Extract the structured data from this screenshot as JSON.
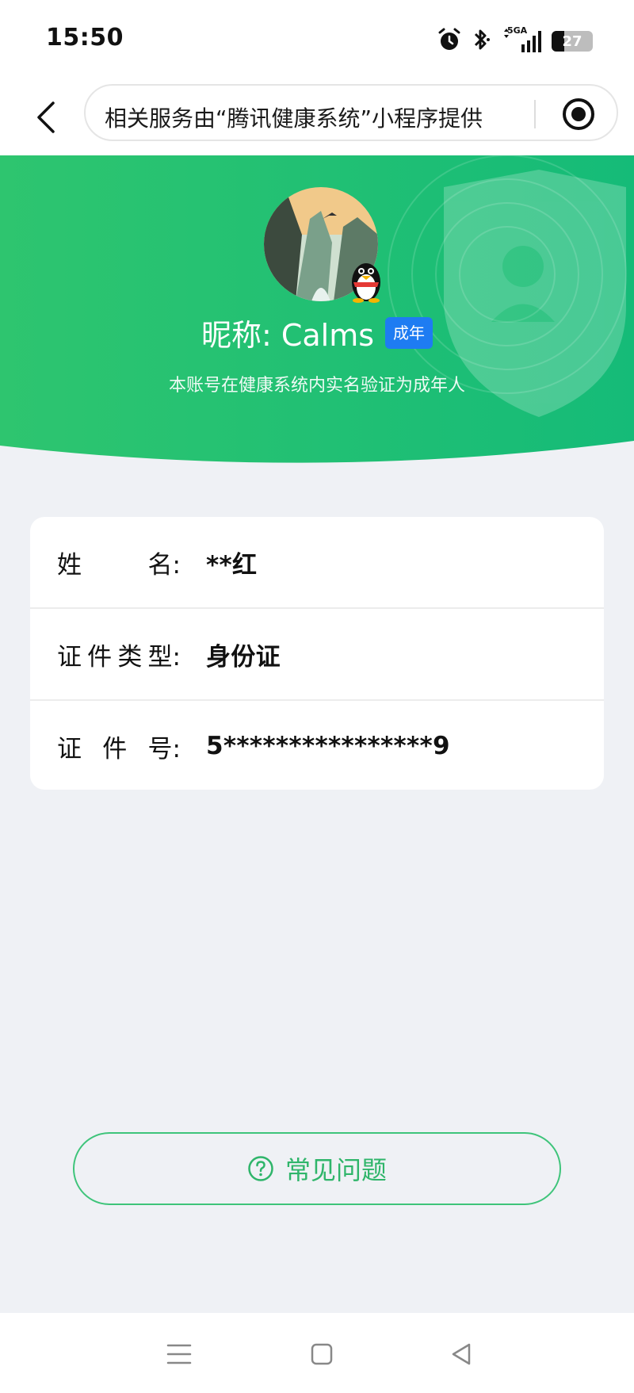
{
  "status_bar": {
    "time": "15:50",
    "network": "5GA",
    "battery": "27",
    "icons": [
      "alarm-icon",
      "bluetooth-icon",
      "signal-icon",
      "battery-icon"
    ]
  },
  "nav": {
    "url_text": "相关服务由“腾讯健康系统”小程序提供",
    "icons": [
      "back-arrow-icon",
      "record-icon"
    ]
  },
  "profile": {
    "nickname": "昵称: Calms",
    "badge": "成年",
    "note": "本账号在健康系统内实名验证为成年人"
  },
  "info": {
    "rows": [
      {
        "label_chars": [
          "姓",
          "名:"
        ],
        "value": "**红"
      },
      {
        "label_chars": [
          "证",
          "件",
          "类",
          "型:"
        ],
        "value": "身份证"
      },
      {
        "label_chars": [
          "证",
          "件",
          "号:"
        ],
        "value": "5****************9"
      }
    ]
  },
  "faq": {
    "label": "常见问题",
    "icon": "question-circle-icon"
  },
  "system_nav": {
    "icons": [
      "menu-icon",
      "home-icon",
      "back-triangle-icon"
    ]
  },
  "colors": {
    "green_top": "#2ec56f",
    "green_bottom": "#15bb78",
    "badge_blue": "#1e7cf2",
    "faq_green": "#2fb56a",
    "page_bg": "#eff1f5"
  }
}
